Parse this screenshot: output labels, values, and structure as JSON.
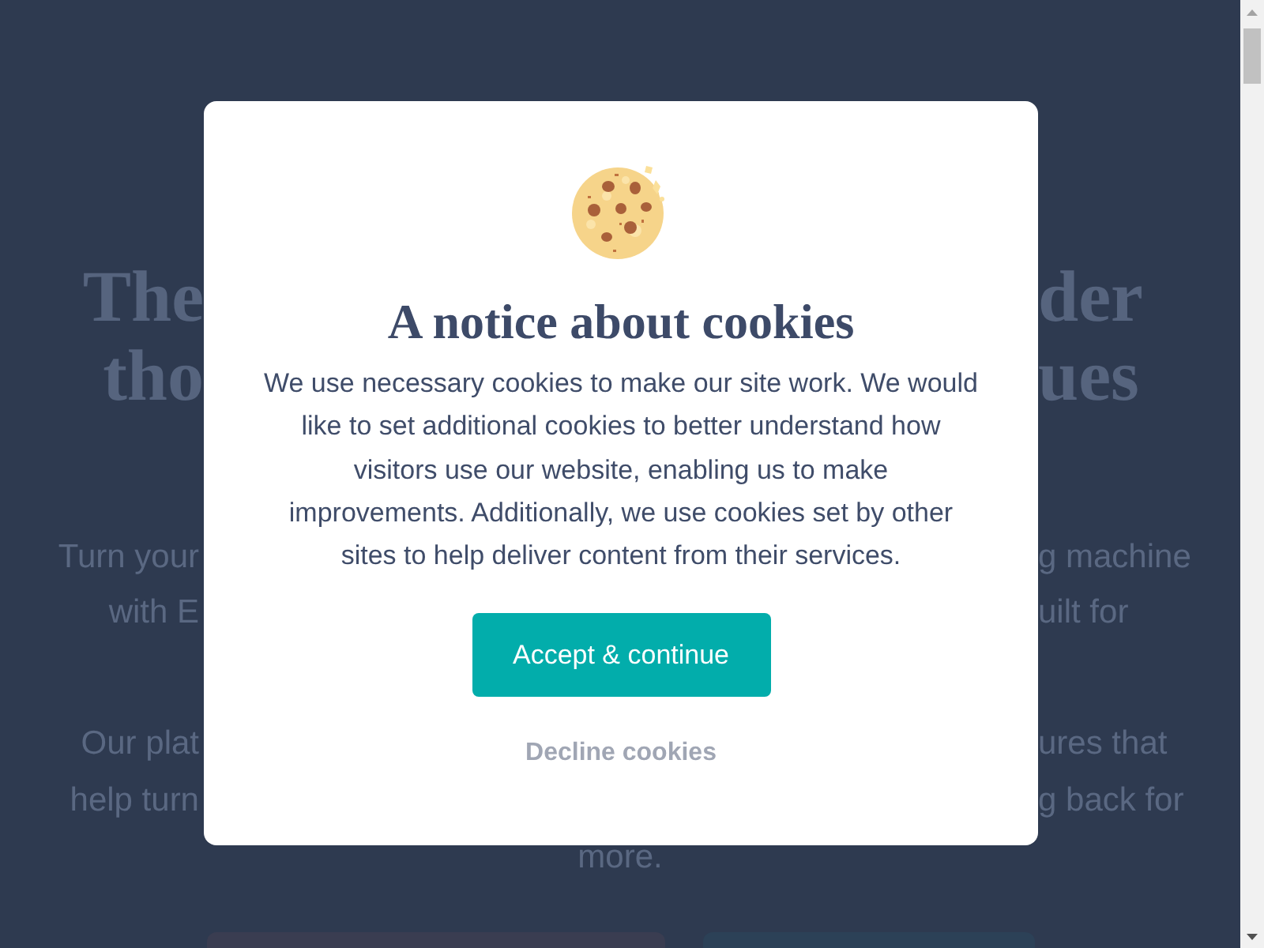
{
  "background_page": {
    "heading_lines": [
      {
        "left": "The",
        "right": "der"
      },
      {
        "left": "tho",
        "right": "ues"
      }
    ],
    "paragraphs": [
      {
        "lines": [
          {
            "left": "Turn your",
            "right": "g machine"
          },
          {
            "left": "with E",
            "right": "uilt for"
          }
        ]
      },
      {
        "lines": [
          {
            "left": "Our plat",
            "right": "ures that"
          },
          {
            "left": "help turn",
            "right": "g back for"
          }
        ],
        "last_line": "more."
      }
    ],
    "buttons": [
      {
        "kind": "secondary"
      },
      {
        "kind": "primary"
      }
    ]
  },
  "cookie_notice": {
    "title": "A notice about cookies",
    "text": "We use necessary cookies to make our site work. We would like to set additional cookies to better understand how visitors use our website, enabling us to make improvements. Additionally, we use cookies set by other sites to help deliver content from their services.",
    "accept_button": "Accept & continue",
    "decline_button": "Decline cookies"
  }
}
